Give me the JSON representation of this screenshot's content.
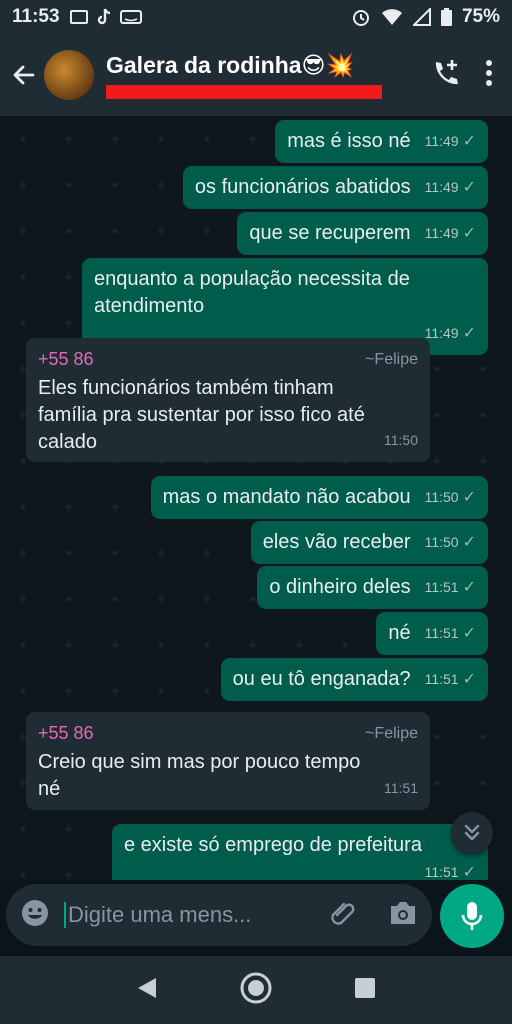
{
  "status_bar": {
    "time": "11:53",
    "battery": "75%"
  },
  "header": {
    "chat_title": "Galera da rodinha😎💥"
  },
  "messages": [
    {
      "type": "out",
      "text": "mas é isso né",
      "time": "11:49"
    },
    {
      "type": "out",
      "text": "os funcionários abatidos",
      "time": "11:49"
    },
    {
      "type": "out",
      "text": "que se recuperem",
      "time": "11:49"
    },
    {
      "type": "out",
      "text": "enquanto a população necessita de atendimento",
      "time": "11:49"
    },
    {
      "type": "in",
      "sender_phone": "+55 86",
      "sender_name": "~Felipe",
      "text": "Eles funcionários também tinham família pra sustentar por isso fico até calado",
      "time": "11:50"
    },
    {
      "type": "out",
      "text": "mas o mandato não acabou",
      "time": "11:50"
    },
    {
      "type": "out",
      "text": "eles vão receber",
      "time": "11:50"
    },
    {
      "type": "out",
      "text": "o dinheiro deles",
      "time": "11:51"
    },
    {
      "type": "out",
      "text": "né",
      "time": "11:51"
    },
    {
      "type": "out",
      "text": "ou eu tô enganada?",
      "time": "11:51"
    },
    {
      "type": "in",
      "sender_phone": "+55 86",
      "sender_name": "~Felipe",
      "text": "Creio que sim mas por pouco tempo né",
      "time": "11:51"
    },
    {
      "type": "out",
      "text": "e existe só emprego de prefeitura",
      "time": "11:51"
    }
  ],
  "composer": {
    "placeholder": "Digite uma mens..."
  },
  "icons": {
    "back": "arrow-left-icon",
    "add_call": "add-call-icon",
    "menu": "more-vertical-icon",
    "emoji": "emoji-icon",
    "attach": "paperclip-icon",
    "camera": "camera-icon",
    "mic": "microphone-icon",
    "scroll_down": "double-chevron-down-icon"
  },
  "colors": {
    "outgoing_bubble": "#005c4b",
    "incoming_bubble": "#1f2c34",
    "accent": "#00a884",
    "sender_phone": "#e26ab6"
  }
}
